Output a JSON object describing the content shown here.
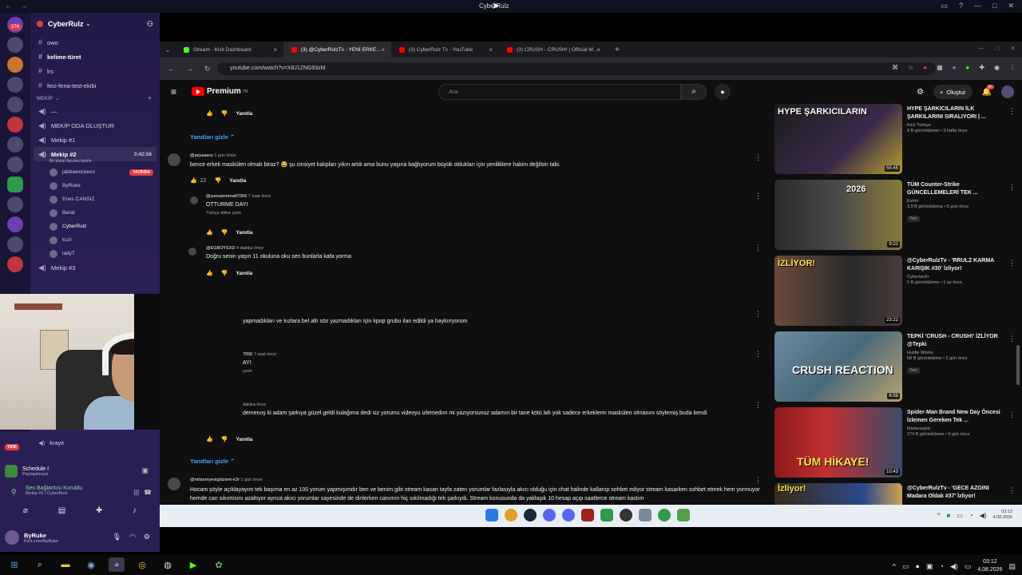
{
  "window": {
    "title": "CyberRulz",
    "nav": "← →"
  },
  "discord": {
    "server_name": "CyberRulz",
    "badge": "174",
    "channels": [
      {
        "name": "owo",
        "bold": false
      },
      {
        "name": "kelime-türet",
        "bold": true
      },
      {
        "name": "lrs",
        "bold": false
      },
      {
        "name": "feci-fena-test-ekibi",
        "bold": false
      }
    ],
    "category": "MEKİP",
    "category_channels": [
      {
        "name": "—"
      },
      {
        "name": "MEKİP ODA OLUŞTUR"
      },
      {
        "name": "Mekip #1"
      }
    ],
    "active_channel": {
      "name": "Mekip #2",
      "time": "3:42:56",
      "status": "Bir kanal durumu belirle"
    },
    "members": [
      {
        "name": "jabbawockeez",
        "live": "YAYINDA"
      },
      {
        "name": "ByRuke",
        "live": ""
      },
      {
        "name": "Enes CANSIZ",
        "live": ""
      },
      {
        "name": "Berat",
        "live": ""
      },
      {
        "name": "CyberRulz",
        "live": ""
      },
      {
        "name": "kuzi",
        "live": ""
      },
      {
        "name": "ladyT",
        "live": ""
      }
    ],
    "next_channel": "Mekip #3",
    "voice_channel": "krayir",
    "new_badge": "YENİ",
    "activity": {
      "title": "Schedule I",
      "sub": "Paylaşılmıyor"
    },
    "connection": {
      "title": "Ses Bağlantısı Kuruldu",
      "sub": "Mekip #2 / CyberRulz"
    },
    "user": {
      "name": "ByRuke",
      "status": "Kick.com/ByRuke"
    }
  },
  "browser": {
    "tabs": [
      {
        "label": "Stream - Kick Dashboard",
        "color": "#53fc18",
        "active": false
      },
      {
        "label": "(3) @CyberRulzTv - YENİ ERKE...",
        "color": "#ff0000",
        "active": true
      },
      {
        "label": "(3) CyberRulz Tv - YouTube",
        "color": "#ff0000",
        "active": false
      },
      {
        "label": "(3) CRUSH - CRUSH! | Official M...",
        "color": "#ff0000",
        "active": false
      }
    ],
    "url": "youtube.com/watch?v=X8J1ZNG93zM"
  },
  "youtube": {
    "logo": "Premium",
    "logo_tr": "TR",
    "search_placeholder": "Ara",
    "create_label": "Oluştur",
    "notif_count": "9+",
    "reply_label": "Yanıtla",
    "hide_replies": "Yanıtları gizle",
    "comments": [
      {
        "author": "@asyaaavy",
        "time": "1 gün önce",
        "text": "bence erkek maskülen olmalı biraz? 😂 şu cinsiyet kalıpları yıkın artık ama bunu yaşına bağlıyorum büyük oldukları için yeniliklere hakim değilsin tabi.",
        "likes": "22"
      },
      {
        "author": "@yunusemreatf7056",
        "time": "7 saat önce",
        "text": "OTTURME DAYI",
        "sub": "Türkçe diline çevir"
      },
      {
        "author": "@EGBOYSXD",
        "time": "4 dakika önce",
        "text": "Doğru senin yaşın 11 okuluna oku sen bunlarla kafa yorma"
      },
      {
        "author": "",
        "time": "",
        "text": "yapmadıkları ve kızlara bel altı söz yazmadıkları için kpop grubu ilan edildi ya haykırıyorum"
      },
      {
        "author": "7056",
        "time": "7 saat önce",
        "text": "AYI",
        "sub": "çevir"
      },
      {
        "author": "",
        "time": "dakika önce",
        "text": "demenıış ki adam şarkıya güzel geldi kulağıma dedi siz yorumu videoyu izlemedım mi yazıyorsunuz adamın bir tane kötü lafı yok sadece erkeklerin maskülen olmasını söylemiş buda kendi"
      },
      {
        "author": "@milanmyeolgidziem-k3r",
        "time": "1 gün önce",
        "text": "Hocam şöyle açıklayayım tek başıma en az 100 yorum yapmışımdır ben ve benim gibi stream kasan tayfa zaten yorumlar fazlasıyla akıcı olduğu için chat halinde kallanıp sohbet ediyor stream kasarken sohbet etmek hem yormuyor hemde can sıkıntısını azaltıyor ayrıca akıcı yorumlar sayesinde de dinlerken canımın hiç sıkılmadığı tek şarkıydı. Stream konusunda da yaklaşık 10 hesap açıp saatlerce stream kastım"
      }
    ],
    "recs": [
      {
        "title": "HYPE ŞARKICILARIN İLK ŞARKILARINI SIRALIYORI | ...",
        "channel": "Kick Türkiye",
        "stats": "8 B görüntüleme • 3 hafta önce",
        "duration": "55:45",
        "thumb_text": "HYPE ŞARKICILARIN",
        "new": ""
      },
      {
        "title": "TÜM Counter-Strike GÜNCELLEMELERİ TEK ...",
        "channel": "Evrim",
        "stats": "3,9 B görüntüleme • 5 gün önce",
        "duration": "9:22",
        "thumb_text": "2026",
        "new": "Yeni"
      },
      {
        "title": "@CyberRulzTv - 'RRULZ KARMA KARIŞIK #30' İzliyor!",
        "channel": "Cyberlanő+",
        "stats": "5 B görüntüleme • 1 ay önce",
        "duration": "23:22",
        "thumb_text": "İZLİYOR!",
        "new": ""
      },
      {
        "title": "TEPKİ 'CRUSH - CRUSH!' İZLİYOR @Tepki",
        "channel": "Hustle Works",
        "stats": "68 B görüntüleme • 2 gün önce",
        "duration": "6:59",
        "thumb_text": "CRUSH REACTION",
        "new": "Yeni"
      },
      {
        "title": "Spider-Man Brand New Day Öncesi İzlemen Gereken Tek ...",
        "channel": "Markeseptic",
        "stats": "274 B görüntüleme • 9 gün önce",
        "duration": "10:43",
        "thumb_text": "TÜM HİKAYE!",
        "new": ""
      },
      {
        "title": "@CyberRulzTv - 'GECE AZGINI Madara Oldak #37' İzliyor!",
        "channel": "",
        "stats": "",
        "duration": "",
        "thumb_text": "İzliyor!",
        "new": ""
      }
    ]
  },
  "inner_clock": {
    "time": "03:12",
    "date": "4.08.2026"
  },
  "taskbar_clock": {
    "time": "03:12",
    "date": "4.08.2026"
  }
}
